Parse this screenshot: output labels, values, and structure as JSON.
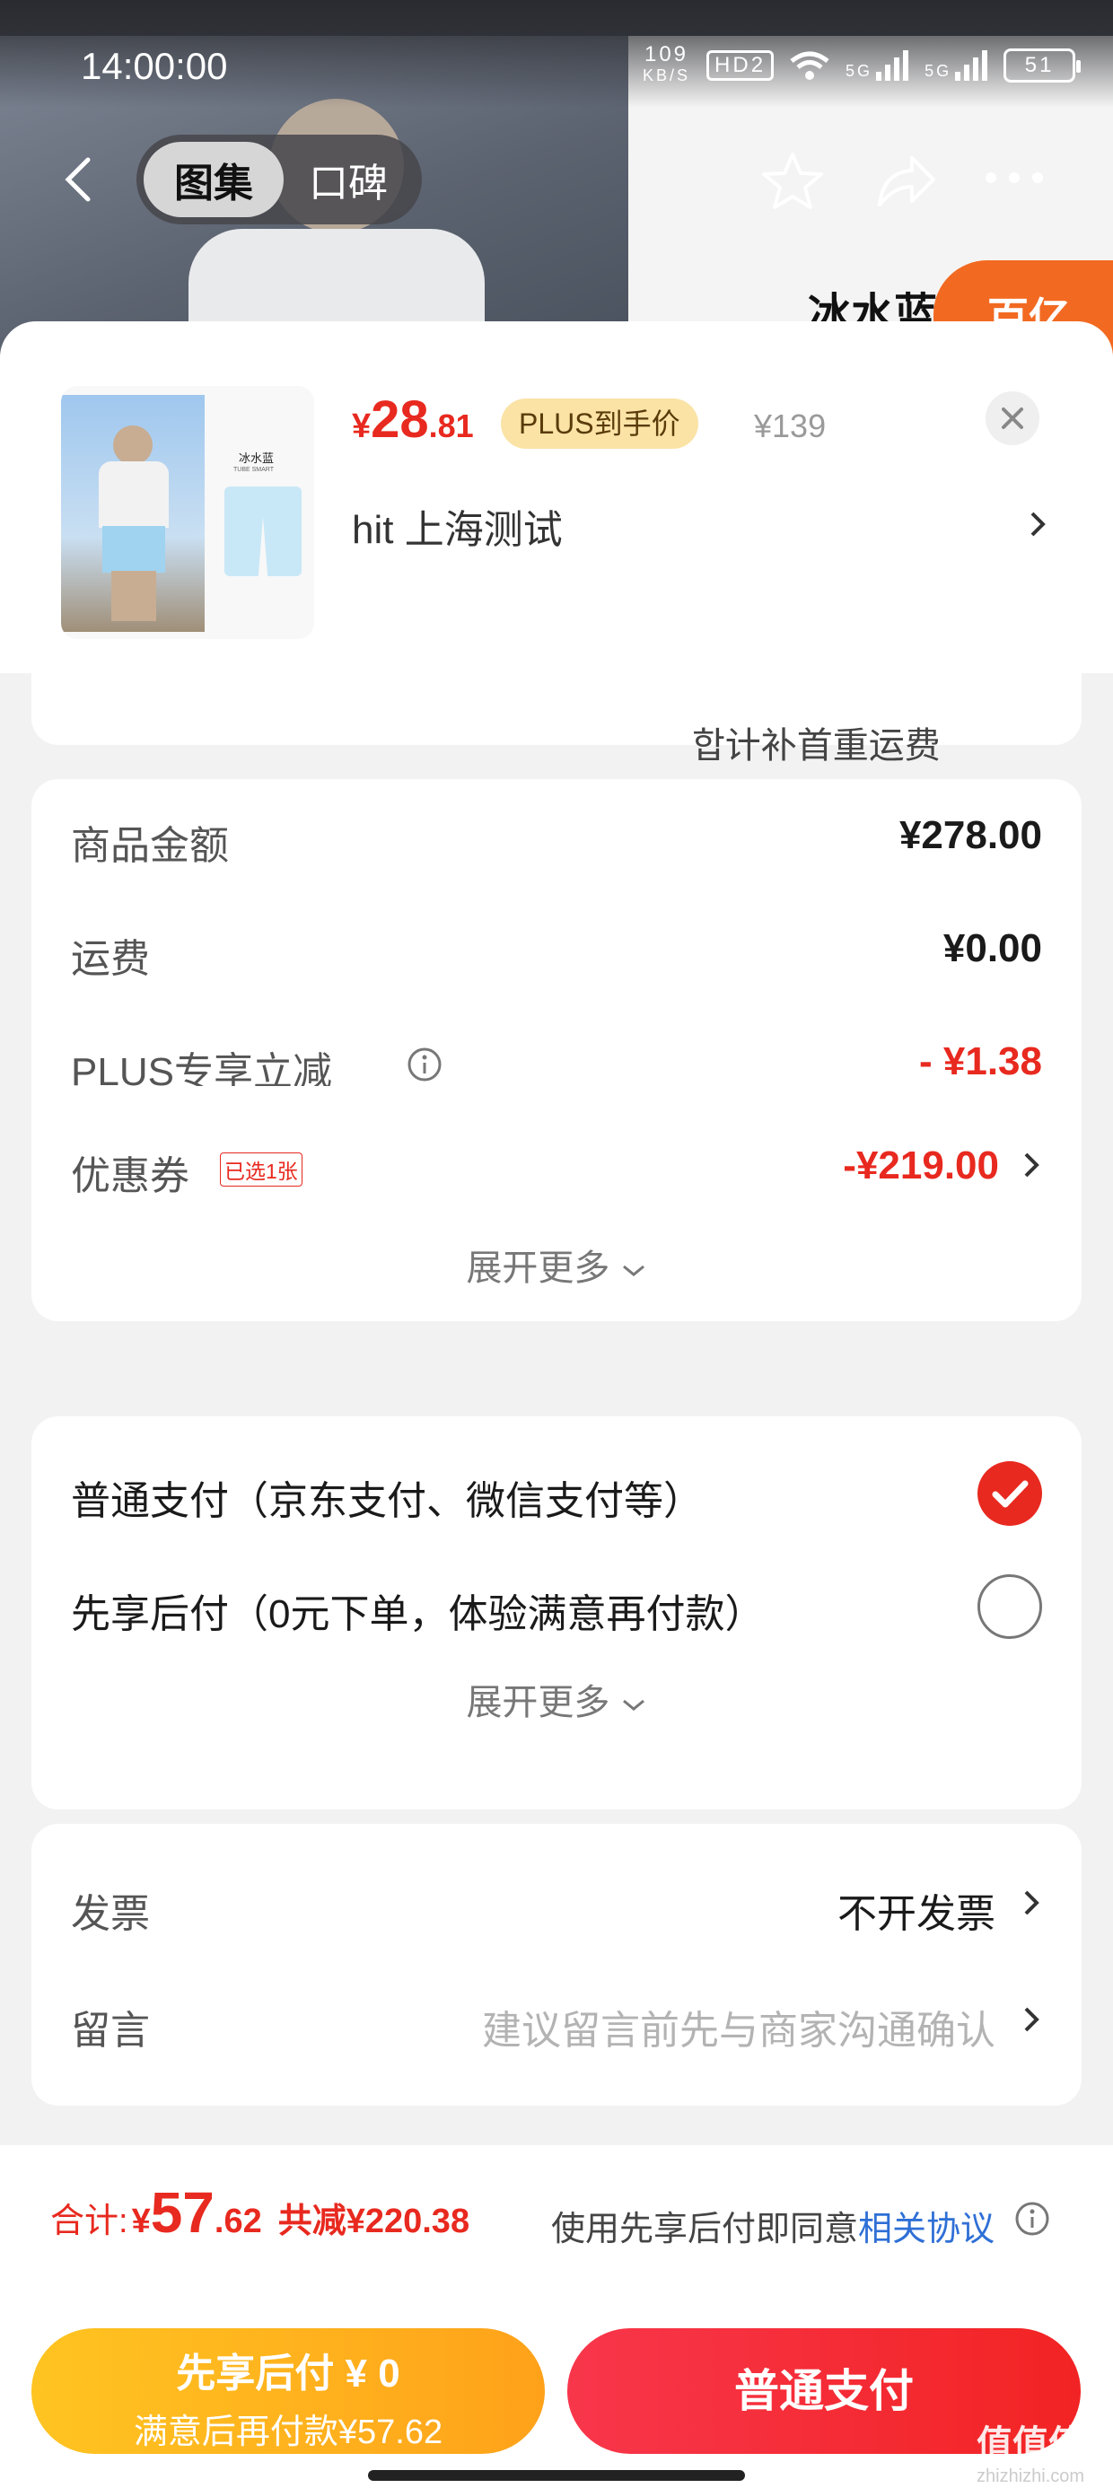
{
  "status_bar": {
    "time": "14:00:00",
    "net_speed": "109",
    "net_speed_unit": "KB/S",
    "hd": "HD2",
    "sig1": "5G",
    "sig2": "5G",
    "battery": "51"
  },
  "background_page": {
    "tabs": [
      "图集",
      "口碑"
    ],
    "product_title_partial": "冰水蓝",
    "badge": "百亿"
  },
  "product": {
    "price_symbol": "¥",
    "price_int": "28",
    "price_dec": ".81",
    "plus_tag": "PLUS到手价",
    "original_price": "¥139",
    "spec": "hit  上海测试",
    "thumb_title": "冰水蓝",
    "thumb_subtitle": "TUBE SMART"
  },
  "previous_card_partial_text": "합计补首重运费",
  "summary": {
    "rows": [
      {
        "label": "商品金额",
        "value": "¥278.00"
      },
      {
        "label": "运费",
        "value": "¥0.00"
      },
      {
        "label": "PLUS专享立减",
        "value": "- ¥1.38"
      },
      {
        "label": "优惠券",
        "value": "-¥219.00",
        "tag": "已选1张"
      }
    ],
    "expand_label": "展开更多"
  },
  "payment": {
    "options": [
      {
        "label": "普通支付（京东支付、微信支付等）",
        "selected": true
      },
      {
        "label": "先享后付（0元下单，体验满意再付款）",
        "selected": false
      }
    ],
    "expand_label": "展开更多"
  },
  "extras": {
    "invoice_label": "发票",
    "invoice_value": "不开发票",
    "message_label": "留言",
    "message_placeholder": "建议留言前先与商家沟通确认"
  },
  "footer": {
    "total_label": "合计:",
    "total_symbol": "¥",
    "total_int": "57",
    "total_dec": ".62",
    "savings": "共减¥220.38",
    "agreement_prefix": "使用先享后付即同意",
    "agreement_link": "相关协议",
    "pay_later_line1": "先享后付 ¥ 0",
    "pay_later_line2": "满意后再付款¥57.62",
    "pay_now": "普通支付"
  },
  "watermark": {
    "main": "值值值",
    "sub": "zhizhizhi.com"
  },
  "colors": {
    "accent_red": "#e8291f",
    "gold": "#ffb21e",
    "link_blue": "#2f6fd6"
  }
}
